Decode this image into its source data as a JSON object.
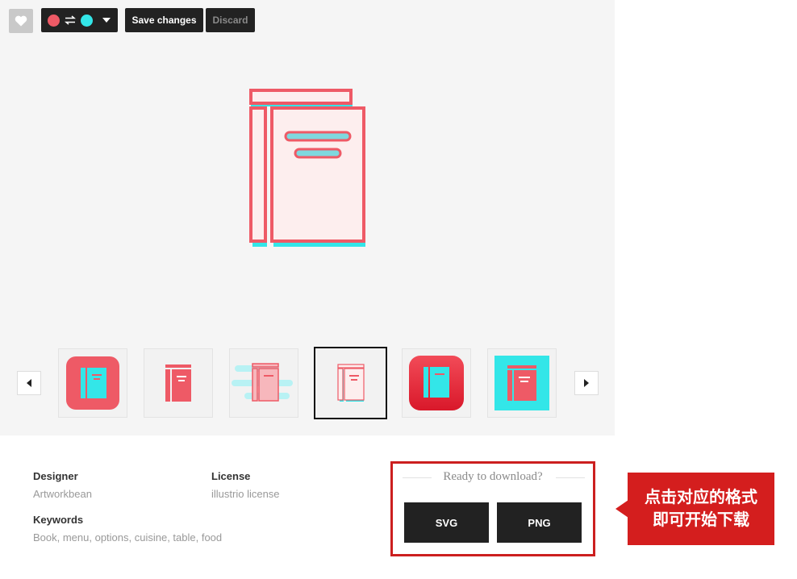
{
  "toolbar": {
    "save_label": "Save changes",
    "discard_label": "Discard",
    "color_primary": "#ee5a66",
    "color_secondary": "#33e6e8"
  },
  "carousel": {
    "selected_index": 3,
    "thumbnails": [
      {
        "style": "red-rounded-square-cyan-book"
      },
      {
        "style": "red-book-plain"
      },
      {
        "style": "pink-book-cyan-lines"
      },
      {
        "style": "outline-book-selected"
      },
      {
        "style": "red-gradient-rounded-cyan-book"
      },
      {
        "style": "cyan-square-red-book"
      }
    ]
  },
  "info": {
    "designer_label": "Designer",
    "designer_value": "Artworkbean",
    "license_label": "License",
    "license_value": "illustrio license",
    "keywords_label": "Keywords",
    "keywords_value": "Book, menu, options, cuisine, table, food"
  },
  "download": {
    "title": "Ready to download?",
    "svg_label": "SVG",
    "png_label": "PNG"
  },
  "callout": {
    "line1": "点击对应的格式",
    "line2": "即可开始下载"
  },
  "colors": {
    "accent_red": "#ee5a66",
    "accent_cyan": "#33e6e8",
    "highlight_red": "#cc1f1f"
  }
}
